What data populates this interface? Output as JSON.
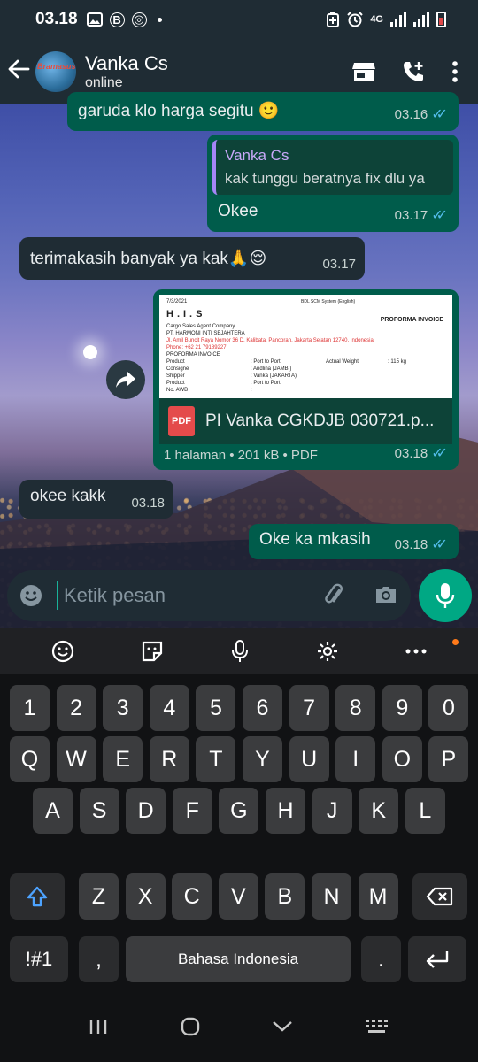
{
  "status_bar": {
    "time": "03.18",
    "network": "4G"
  },
  "header": {
    "contact_name": "Vanka Cs",
    "contact_status": "online",
    "avatar_text": "Bramasusu"
  },
  "messages": [
    {
      "id": "m1",
      "direction": "outgoing",
      "text": "garuda klo harga segitu 🙂",
      "time": "03.16",
      "status": "read"
    },
    {
      "id": "m2",
      "direction": "outgoing",
      "quoted_author": "Vanka Cs",
      "quoted_text": "kak tunggu beratnya fix dlu ya",
      "text": "Okee",
      "time": "03.17",
      "status": "read"
    },
    {
      "id": "m3",
      "direction": "incoming",
      "text": "terimakasih banyak ya kak🙏😌",
      "time": "03.17"
    },
    {
      "id": "m4",
      "direction": "outgoing",
      "type": "document",
      "file_name": "PI Vanka CGKDJB 030721.p...",
      "file_details": "1 halaman • 201 kB • PDF",
      "file_badge": "PDF",
      "time": "03.18",
      "status": "read",
      "preview": {
        "date": "7/3/2021",
        "system": "BDL SCM System (English)",
        "title": "H.I.S",
        "doc_type": "PROFORMA INVOICE",
        "line1": "Cargo Sales Agent Company",
        "line2": "PT. HARMONI INTI SEJAHTERA",
        "address": "Jl. Amil Buncit Raya Nomor 36 D, Kalibata, Pancoran, Jakarta Selatan 12740, Indonesia",
        "phone": "Phone: +62 21 79189227",
        "section": "PROFORMA INVOICE",
        "rows": [
          [
            "Product",
            ": Port to Port",
            "Actual Weight",
            ": 115 kg"
          ],
          [
            "Consigne",
            ": Andlina (JAMBI)",
            "",
            ""
          ],
          [
            "Shipper",
            ": Vanka (JAKARTA)",
            "",
            ""
          ],
          [
            "Product",
            ": Port to Port",
            "",
            ""
          ],
          [
            "No. AWB",
            ":",
            "",
            ""
          ]
        ]
      }
    },
    {
      "id": "m5",
      "direction": "incoming",
      "text": "okee kakk",
      "time": "03.18"
    },
    {
      "id": "m6",
      "direction": "outgoing",
      "text": "Oke ka mkasih",
      "time": "03.18",
      "status": "read"
    }
  ],
  "composer": {
    "placeholder": "Ketik pesan"
  },
  "keyboard": {
    "row_numbers": [
      "1",
      "2",
      "3",
      "4",
      "5",
      "6",
      "7",
      "8",
      "9",
      "0"
    ],
    "row_1": [
      "Q",
      "W",
      "E",
      "R",
      "T",
      "Y",
      "U",
      "I",
      "O",
      "P"
    ],
    "row_2": [
      "A",
      "S",
      "D",
      "F",
      "G",
      "H",
      "J",
      "K",
      "L"
    ],
    "row_3": [
      "Z",
      "X",
      "C",
      "V",
      "B",
      "N",
      "M"
    ],
    "symbols_key": "!#1",
    "comma_key": ",",
    "space_label": "Bahasa Indonesia",
    "period_key": "."
  },
  "colors": {
    "header_bg": "#1f2c34",
    "outgoing_bubble": "#005c4b",
    "incoming_bubble": "#1f2c34",
    "read_tick": "#53bdeb",
    "accent": "#00a884"
  }
}
